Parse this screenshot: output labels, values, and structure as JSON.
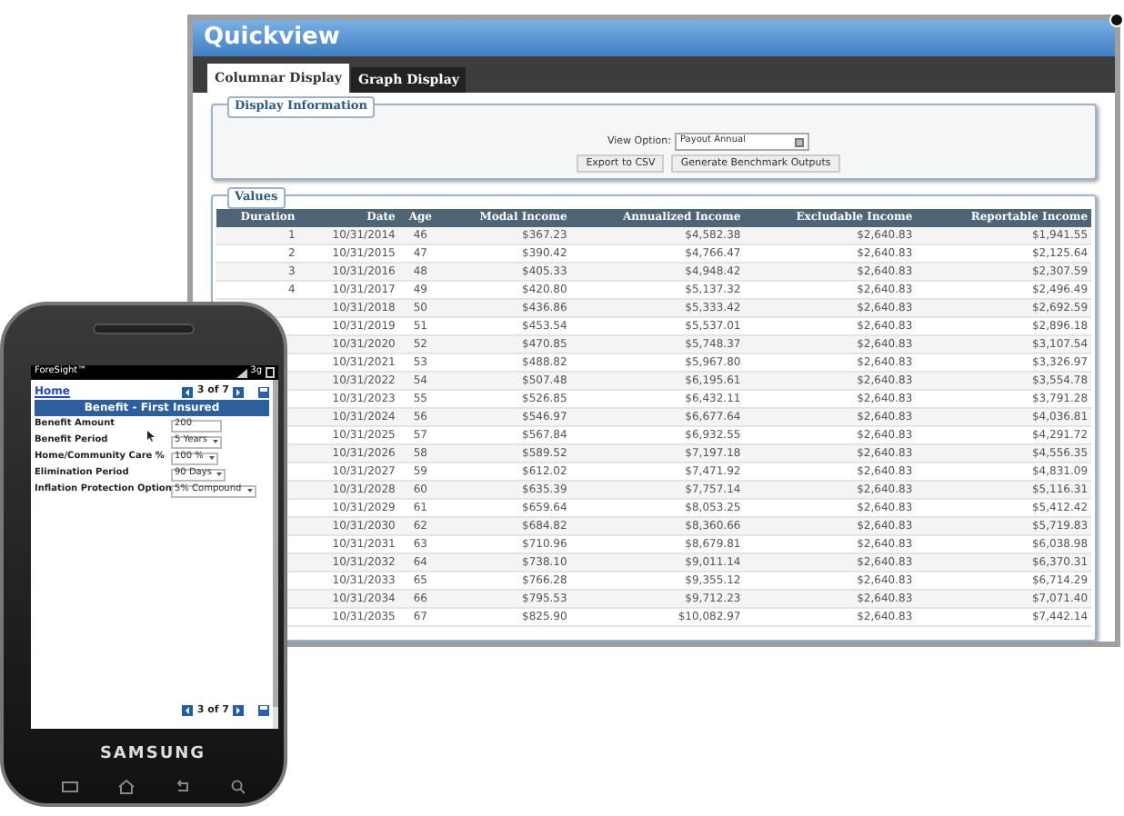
{
  "quickview": {
    "title": "Quickview",
    "tabs": [
      {
        "label": "Columnar Display",
        "selected": true
      },
      {
        "label": "Graph Display",
        "selected": false
      }
    ],
    "display_information": {
      "legend": "Display Information",
      "view_option_label": "View Option:",
      "view_option_value": "Payout Annual",
      "buttons": [
        "Export to CSV",
        "Generate Benchmark Outputs"
      ]
    },
    "values": {
      "legend": "Values",
      "columns": [
        "Duration",
        "Date",
        "Age",
        "Modal Income",
        "Annualized Income",
        "Excludable Income",
        "Reportable Income"
      ],
      "rows": [
        {
          "duration": "1",
          "date": "10/31/2014",
          "age": "46",
          "modal": "$367.23",
          "annualized": "$4,582.38",
          "excludable": "$2,640.83",
          "reportable": "$1,941.55"
        },
        {
          "duration": "2",
          "date": "10/31/2015",
          "age": "47",
          "modal": "$390.42",
          "annualized": "$4,766.47",
          "excludable": "$2,640.83",
          "reportable": "$2,125.64"
        },
        {
          "duration": "3",
          "date": "10/31/2016",
          "age": "48",
          "modal": "$405.33",
          "annualized": "$4,948.42",
          "excludable": "$2,640.83",
          "reportable": "$2,307.59"
        },
        {
          "duration": "4",
          "date": "10/31/2017",
          "age": "49",
          "modal": "$420.80",
          "annualized": "$5,137.32",
          "excludable": "$2,640.83",
          "reportable": "$2,496.49"
        },
        {
          "date": "10/31/2018",
          "age": "50",
          "modal": "$436.86",
          "annualized": "$5,333.42",
          "excludable": "$2,640.83",
          "reportable": "$2,692.59"
        },
        {
          "date": "10/31/2019",
          "age": "51",
          "modal": "$453.54",
          "annualized": "$5,537.01",
          "excludable": "$2,640.83",
          "reportable": "$2,896.18"
        },
        {
          "date": "10/31/2020",
          "age": "52",
          "modal": "$470.85",
          "annualized": "$5,748.37",
          "excludable": "$2,640.83",
          "reportable": "$3,107.54"
        },
        {
          "date": "10/31/2021",
          "age": "53",
          "modal": "$488.82",
          "annualized": "$5,967.80",
          "excludable": "$2,640.83",
          "reportable": "$3,326.97"
        },
        {
          "date": "10/31/2022",
          "age": "54",
          "modal": "$507.48",
          "annualized": "$6,195.61",
          "excludable": "$2,640.83",
          "reportable": "$3,554.78"
        },
        {
          "date": "10/31/2023",
          "age": "55",
          "modal": "$526.85",
          "annualized": "$6,432.11",
          "excludable": "$2,640.83",
          "reportable": "$3,791.28"
        },
        {
          "date": "10/31/2024",
          "age": "56",
          "modal": "$546.97",
          "annualized": "$6,677.64",
          "excludable": "$2,640.83",
          "reportable": "$4,036.81"
        },
        {
          "date": "10/31/2025",
          "age": "57",
          "modal": "$567.84",
          "annualized": "$6,932.55",
          "excludable": "$2,640.83",
          "reportable": "$4,291.72"
        },
        {
          "date": "10/31/2026",
          "age": "58",
          "modal": "$589.52",
          "annualized": "$7,197.18",
          "excludable": "$2,640.83",
          "reportable": "$4,556.35"
        },
        {
          "date": "10/31/2027",
          "age": "59",
          "modal": "$612.02",
          "annualized": "$7,471.92",
          "excludable": "$2,640.83",
          "reportable": "$4,831.09"
        },
        {
          "date": "10/31/2028",
          "age": "60",
          "modal": "$635.39",
          "annualized": "$7,757.14",
          "excludable": "$2,640.83",
          "reportable": "$5,116.31"
        },
        {
          "date": "10/31/2029",
          "age": "61",
          "modal": "$659.64",
          "annualized": "$8,053.25",
          "excludable": "$2,640.83",
          "reportable": "$5,412.42"
        },
        {
          "date": "10/31/2030",
          "age": "62",
          "modal": "$684.82",
          "annualized": "$8,360.66",
          "excludable": "$2,640.83",
          "reportable": "$5,719.83"
        },
        {
          "date": "10/31/2031",
          "age": "63",
          "modal": "$710.96",
          "annualized": "$8,679.81",
          "excludable": "$2,640.83",
          "reportable": "$6,038.98"
        },
        {
          "date": "10/31/2032",
          "age": "64",
          "modal": "$738.10",
          "annualized": "$9,011.14",
          "excludable": "$2,640.83",
          "reportable": "$6,370.31"
        },
        {
          "date": "10/31/2033",
          "age": "65",
          "modal": "$766.28",
          "annualized": "$9,355.12",
          "excludable": "$2,640.83",
          "reportable": "$6,714.29"
        },
        {
          "date": "10/31/2034",
          "age": "66",
          "modal": "$795.53",
          "annualized": "$9,712.23",
          "excludable": "$2,640.83",
          "reportable": "$7,071.40"
        },
        {
          "date": "10/31/2035",
          "age": "67",
          "modal": "$825.90",
          "annualized": "$10,082.97",
          "excludable": "$2,640.83",
          "reportable": "$7,442.14"
        }
      ]
    }
  },
  "phone": {
    "status_bar": {
      "app_name": "ForeSight™",
      "network": "3g"
    },
    "home_link": "Home",
    "pager_top": "3 of 7",
    "form_title": "Benefit - First Insured",
    "fields": [
      {
        "label": "Benefit Amount",
        "kind": "input",
        "value": "200"
      },
      {
        "label": "Benefit Period",
        "kind": "select",
        "value": "5 Years"
      },
      {
        "label": "Home/Community Care %",
        "kind": "select",
        "value": "100 %"
      },
      {
        "label": "Elimination Period",
        "kind": "select",
        "value": "90 Days"
      },
      {
        "label": "Inflation Protection Option",
        "kind": "select",
        "value": "5% Compound"
      }
    ],
    "pager_bottom": "3 of 7",
    "brand": "SAMSUNG"
  }
}
